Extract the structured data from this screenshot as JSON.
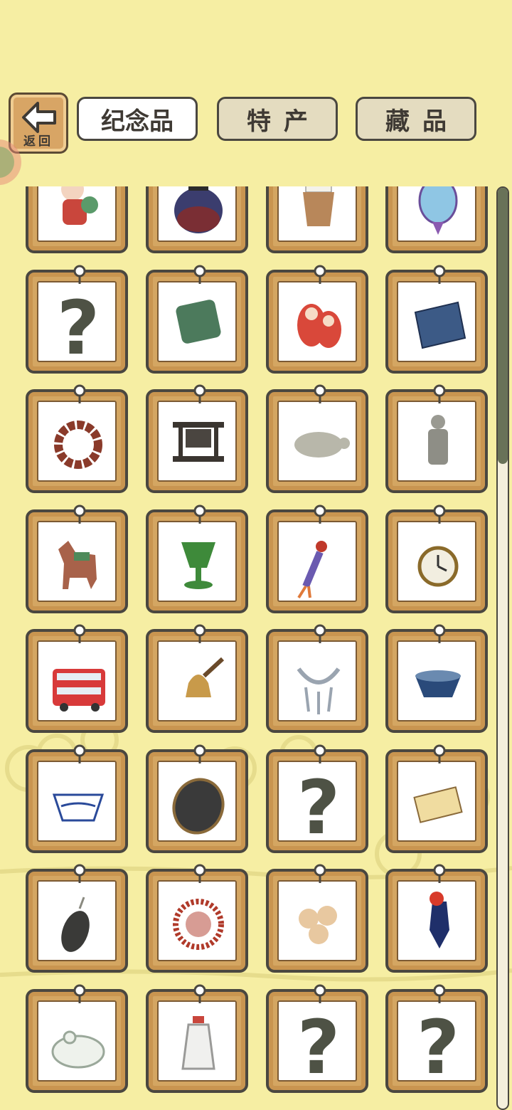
{
  "header": {
    "back_label": "返回",
    "tabs": [
      {
        "label": "纪念品",
        "active": true
      },
      {
        "label": "特产",
        "active": false
      },
      {
        "label": "藏品",
        "active": false
      }
    ]
  },
  "colors": {
    "background": "#f6eea3",
    "card_wood": "#d4a662",
    "outline": "#4a4740",
    "scroll_thumb": "#697258"
  },
  "scroll": {
    "position_fraction": 0.0,
    "visible_fraction": 0.3
  },
  "grid": {
    "columns": 4,
    "items": [
      {
        "icon": "doll-figurine-icon",
        "found": true
      },
      {
        "icon": "clay-jar-icon",
        "found": true
      },
      {
        "icon": "woven-basket-cup-icon",
        "found": true
      },
      {
        "icon": "cloisonne-lantern-icon",
        "found": true
      },
      {
        "icon": "unknown-question-icon",
        "found": false
      },
      {
        "icon": "jade-plaque-icon",
        "found": true
      },
      {
        "icon": "matryoshka-doll-icon",
        "found": true
      },
      {
        "icon": "blue-scarf-icon",
        "found": true
      },
      {
        "icon": "prayer-beads-icon",
        "found": true
      },
      {
        "icon": "chime-bells-icon",
        "found": true
      },
      {
        "icon": "stone-turtle-icon",
        "found": true
      },
      {
        "icon": "terracotta-warrior-icon",
        "found": true
      },
      {
        "icon": "tang-horse-icon",
        "found": true
      },
      {
        "icon": "jade-goblet-icon",
        "found": true
      },
      {
        "icon": "chinese-knot-tassel-icon",
        "found": true
      },
      {
        "icon": "pocket-watch-icon",
        "found": true
      },
      {
        "icon": "double-decker-bus-icon",
        "found": true
      },
      {
        "icon": "hand-bell-icon",
        "found": true
      },
      {
        "icon": "silver-necklace-icon",
        "found": true
      },
      {
        "icon": "tea-bowl-icon",
        "found": true
      },
      {
        "icon": "porcelain-bowl-icon",
        "found": true
      },
      {
        "icon": "ink-stone-icon",
        "found": true
      },
      {
        "icon": "unknown-question-icon",
        "found": false
      },
      {
        "icon": "tea-brick-icon",
        "found": true
      },
      {
        "icon": "dark-stone-pendant-icon",
        "found": true
      },
      {
        "icon": "paper-cut-seal-icon",
        "found": true
      },
      {
        "icon": "dango-skewer-icon",
        "found": true
      },
      {
        "icon": "rooster-figure-icon",
        "found": true
      },
      {
        "icon": "jade-frog-icon",
        "found": true
      },
      {
        "icon": "snuff-bottle-icon",
        "found": true
      },
      {
        "icon": "unknown-question-icon",
        "found": false
      },
      {
        "icon": "unknown-question-icon",
        "found": false
      }
    ]
  }
}
